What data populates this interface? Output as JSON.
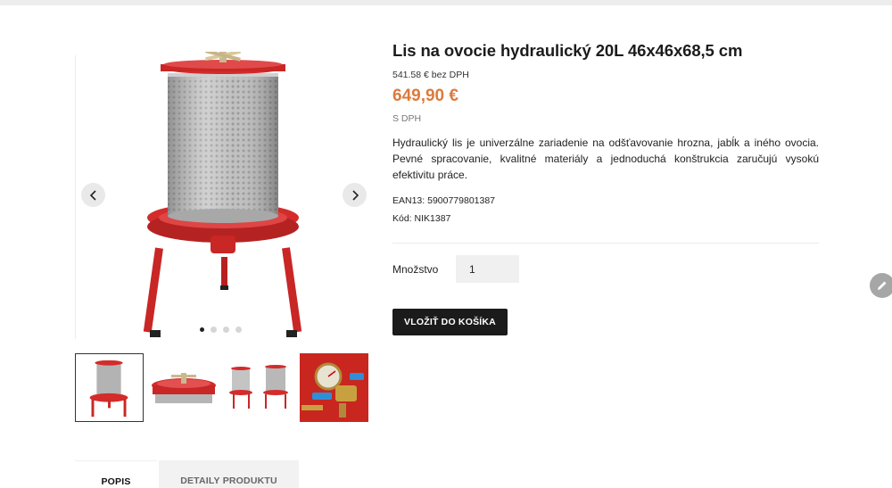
{
  "product": {
    "title": "Lis na ovocie hydraulický 20L 46x46x68,5 cm",
    "price_net": "541.58 € bez DPH",
    "price": "649,90 €",
    "vat_note": "S DPH",
    "description": "Hydraulický lis je univerzálne zariadenie na odšťavovanie hrozna, jabĺk a iného ovocia. Pevné spracovanie, kvalitné materiály a jednoduchá konštrukcia zaručujú vysokú efektivitu práce.",
    "ean": "EAN13: 5900779801387",
    "code": "Kód: NIK1387"
  },
  "purchase": {
    "qty_label": "Množstvo",
    "qty_value": "1",
    "add_to_cart": "VLOŽIŤ DO KOŠÍKA"
  },
  "gallery": {
    "slide_count": 4,
    "active_slide": 1,
    "thumbnails": [
      "press-front",
      "press-lid",
      "press-set",
      "pressure-gauge"
    ]
  },
  "tabs": [
    {
      "label": "POPIS",
      "active": true
    },
    {
      "label": "DETAILY PRODUKTU",
      "active": false
    }
  ],
  "colors": {
    "price": "#dc7a3d",
    "button": "#1b1b1b",
    "press_red": "#d42b2b"
  },
  "icons": {
    "prev": "chevron-left-icon",
    "next": "chevron-right-icon",
    "edit": "pencil-icon"
  }
}
